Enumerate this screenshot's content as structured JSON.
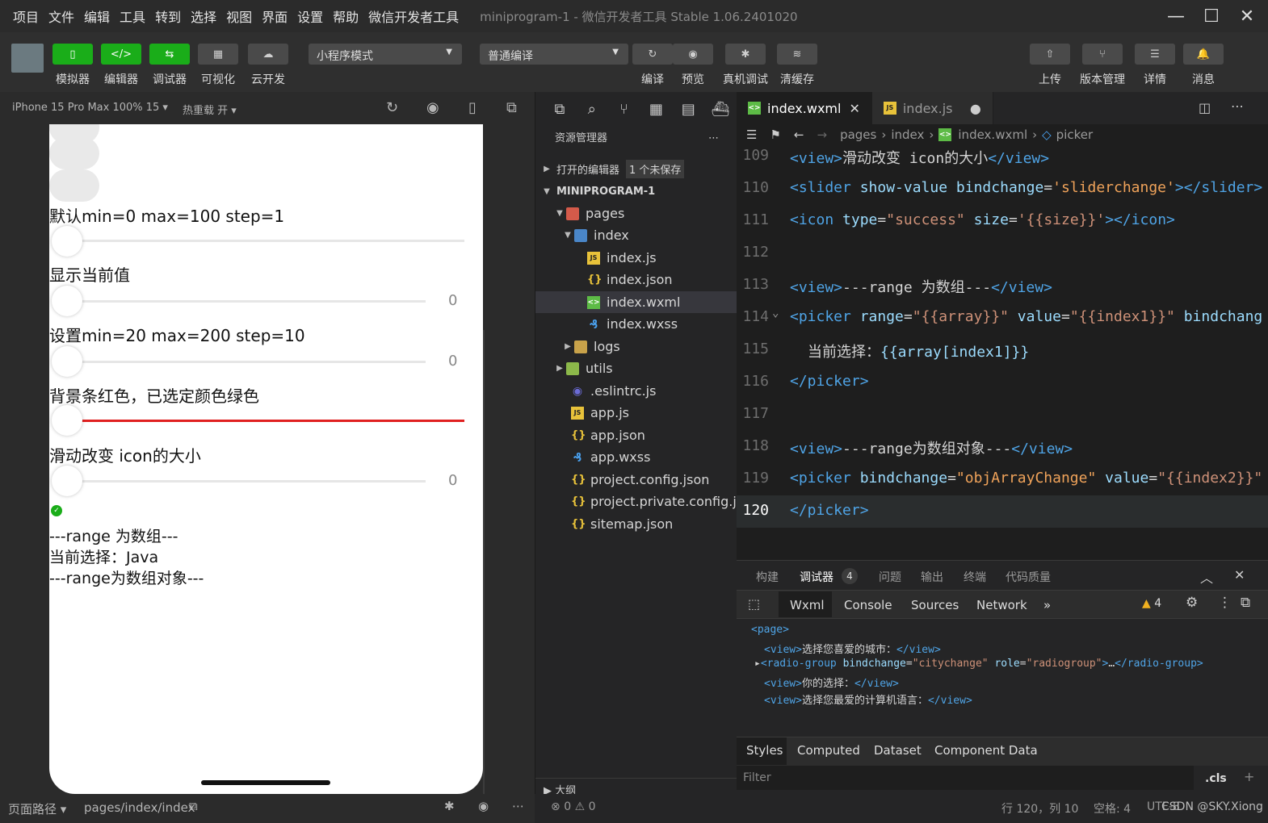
{
  "menu": [
    "项目",
    "文件",
    "编辑",
    "工具",
    "转到",
    "选择",
    "视图",
    "界面",
    "设置",
    "帮助",
    "微信开发者工具"
  ],
  "window_title": "miniprogram-1 - 微信开发者工具 Stable 1.06.2401020",
  "toolbar": {
    "left_buttons": [
      "模拟器",
      "编辑器",
      "调试器",
      "可视化",
      "云开发"
    ],
    "mode_select": "小程序模式",
    "compile_select": "普通编译",
    "mid_buttons": [
      "编译",
      "预览",
      "真机调试",
      "清缓存"
    ],
    "right_buttons": [
      "上传",
      "版本管理",
      "详情",
      "消息"
    ]
  },
  "simulator": {
    "device": "iPhone 15 Pro Max 100% 15",
    "hot_reload": "热重载 开",
    "texts": {
      "t1": "默认min=0 max=100 step=1",
      "t2": "显示当前值",
      "t3": "设置min=20 max=200 step=10",
      "t4": "背景条红色，已选定颜色绿色",
      "t5": "滑动改变 icon的大小",
      "t6": "---range 为数组---",
      "t7": "当前选择：Java",
      "t8": "---range为数组对象---"
    },
    "slider_values": [
      "0",
      "0",
      "0"
    ],
    "footer_path_label": "页面路径",
    "footer_path": "pages/index/index"
  },
  "explorer": {
    "title": "资源管理器",
    "open_editors": "打开的编辑器",
    "unsaved": "1 个未保存",
    "project": "MINIPROGRAM-1",
    "files": [
      "pages",
      "index",
      "index.js",
      "index.json",
      "index.wxml",
      "index.wxss",
      "logs",
      "utils",
      ".eslintrc.js",
      "app.js",
      "app.json",
      "app.wxss",
      "project.config.json",
      "project.private.config.js...",
      "sitemap.json"
    ],
    "outline": "大纲"
  },
  "editor": {
    "tabs": [
      "index.wxml",
      "index.js"
    ],
    "breadcrumb": [
      "pages",
      "index",
      "index.wxml",
      "picker"
    ],
    "line_numbers": [
      "109",
      "110",
      "111",
      "112",
      "113",
      "114",
      "115",
      "116",
      "117",
      "118",
      "119",
      "120"
    ]
  },
  "panel": {
    "tabs": [
      "构建",
      "调试器",
      "问题",
      "输出",
      "终端",
      "代码质量"
    ],
    "debugger_badge": "4",
    "devtools_tabs": [
      "Wxml",
      "Console",
      "Sources",
      "Network"
    ],
    "warnings": "4",
    "style_tabs": [
      "Styles",
      "Computed",
      "Dataset",
      "Component Data"
    ],
    "filter": "Filter",
    "cls": ".cls"
  },
  "status": {
    "errors": "0",
    "warnings": "0",
    "position": "行 120，列 10",
    "spaces": "空格: 4",
    "encoding": "UTF-8",
    "watermark": "CSDN @SKY.Xiong"
  }
}
